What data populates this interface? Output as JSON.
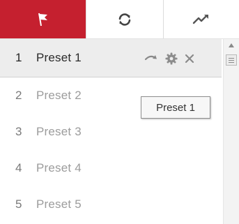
{
  "tabs": [
    {
      "icon": "flag-icon",
      "active": true
    },
    {
      "icon": "refresh-icon",
      "active": false
    },
    {
      "icon": "trend-icon",
      "active": false
    }
  ],
  "presets": [
    {
      "number": "1",
      "name": "Preset 1",
      "selected": true
    },
    {
      "number": "2",
      "name": "Preset 2",
      "selected": false
    },
    {
      "number": "3",
      "name": "Preset 3",
      "selected": false
    },
    {
      "number": "4",
      "name": "Preset 4",
      "selected": false
    },
    {
      "number": "5",
      "name": "Preset 5",
      "selected": false
    }
  ],
  "row_actions": {
    "call": "call-preset-icon",
    "settings": "gear-icon",
    "delete": "close-icon"
  },
  "tooltip": {
    "text": "Preset 1"
  },
  "colors": {
    "accent": "#c5202f",
    "selected_row": "#ededed"
  }
}
